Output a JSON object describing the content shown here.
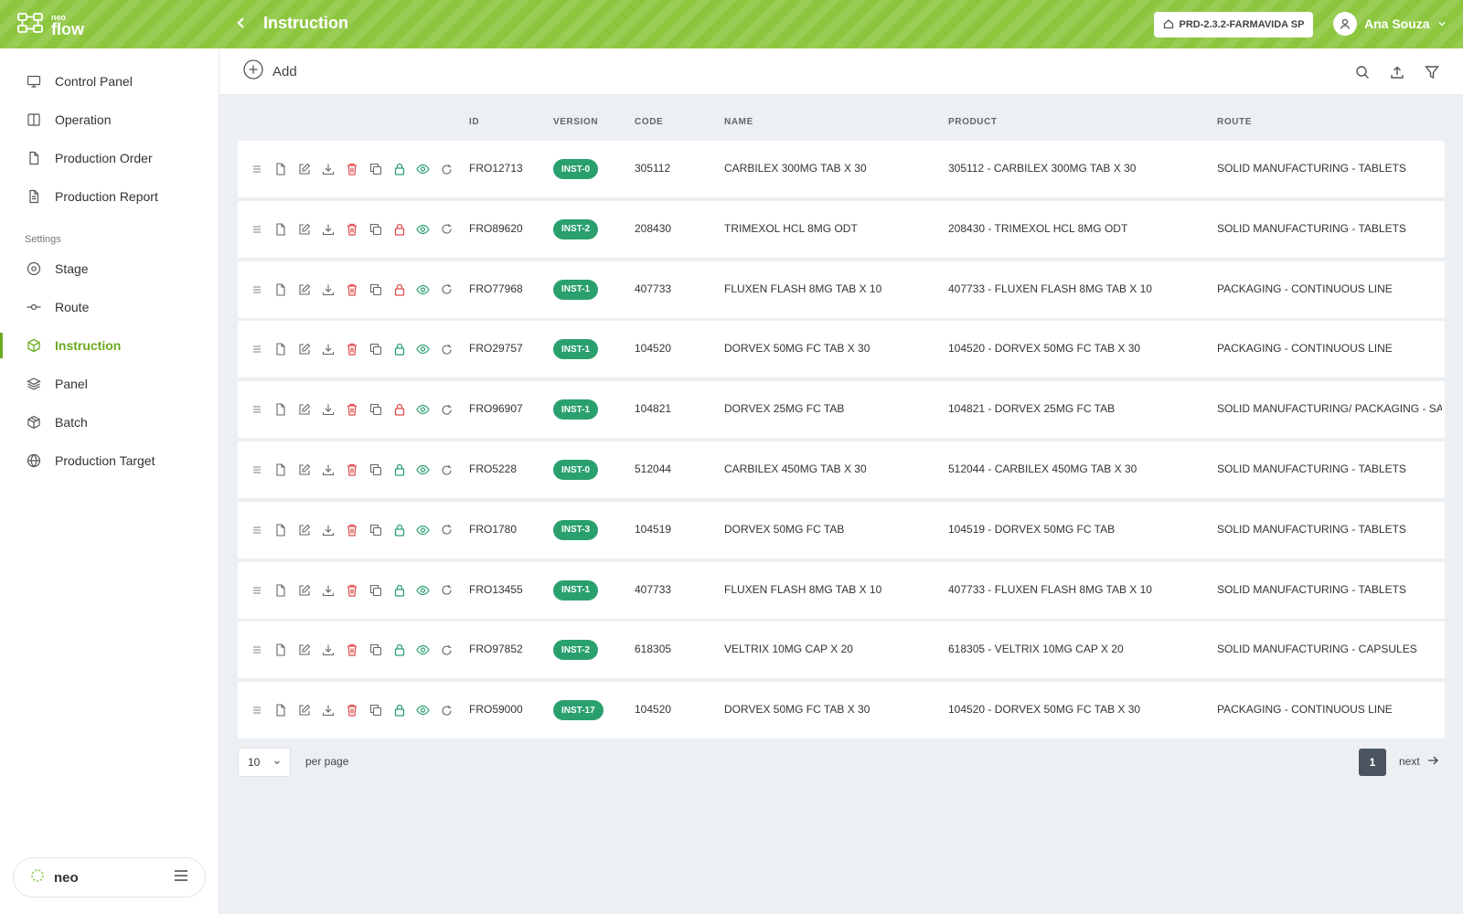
{
  "brand": {
    "small": "neo",
    "big": "flow"
  },
  "header": {
    "title": "Instruction",
    "environment": "PRD-2.3.2-FARMAVIDA SP",
    "user_name": "Ana Souza"
  },
  "sidebar": {
    "items": [
      {
        "label": "Control Panel",
        "icon": "monitor-icon"
      },
      {
        "label": "Operation",
        "icon": "columns-icon"
      },
      {
        "label": "Production Order",
        "icon": "file-icon"
      },
      {
        "label": "Production Report",
        "icon": "file-text-icon"
      }
    ],
    "settings_label": "Settings",
    "settings_items": [
      {
        "label": "Stage",
        "icon": "disc-icon"
      },
      {
        "label": "Route",
        "icon": "route-icon"
      },
      {
        "label": "Instruction",
        "icon": "box-icon",
        "active": true
      },
      {
        "label": "Panel",
        "icon": "layers-icon"
      },
      {
        "label": "Batch",
        "icon": "package-icon"
      },
      {
        "label": "Production Target",
        "icon": "globe-icon"
      }
    ],
    "footer_brand": "neo"
  },
  "toolbar": {
    "add_label": "Add"
  },
  "table": {
    "columns": {
      "id": "ID",
      "version": "VERSION",
      "code": "CODE",
      "name": "NAME",
      "product": "PRODUCT",
      "route": "ROUTE"
    },
    "rows": [
      {
        "id": "FRO12713",
        "version": "INST-0",
        "code": "305112",
        "name": "CARBILEX 300MG TAB X 30",
        "product": "305112 - CARBILEX 300MG TAB X 30",
        "route": "SOLID MANUFACTURING - TABLETS",
        "locked": false
      },
      {
        "id": "FRO89620",
        "version": "INST-2",
        "code": "208430",
        "name": "TRIMEXOL HCL 8MG ODT",
        "product": "208430 - TRIMEXOL HCL 8MG ODT",
        "route": "SOLID MANUFACTURING - TABLETS",
        "locked": true
      },
      {
        "id": "FRO77968",
        "version": "INST-1",
        "code": "407733",
        "name": "FLUXEN FLASH 8MG TAB X 10",
        "product": "407733 - FLUXEN FLASH 8MG TAB X 10",
        "route": "PACKAGING - CONTINUOUS LINE",
        "locked": true
      },
      {
        "id": "FRO29757",
        "version": "INST-1",
        "code": "104520",
        "name": "DORVEX 50MG FC TAB X 30",
        "product": "104520 - DORVEX 50MG FC TAB X 30",
        "route": "PACKAGING - CONTINUOUS LINE",
        "locked": false
      },
      {
        "id": "FRO96907",
        "version": "INST-1",
        "code": "104821",
        "name": "DORVEX 25MG FC TAB",
        "product": "104821 - DORVEX 25MG FC TAB",
        "route": "SOLID MANUFACTURING/ PACKAGING - SA",
        "locked": true
      },
      {
        "id": "FRO5228",
        "version": "INST-0",
        "code": "512044",
        "name": "CARBILEX 450MG TAB X 30",
        "product": "512044 - CARBILEX 450MG TAB X 30",
        "route": "SOLID MANUFACTURING - TABLETS",
        "locked": false
      },
      {
        "id": "FRO1780",
        "version": "INST-3",
        "code": "104519",
        "name": "DORVEX 50MG FC TAB",
        "product": "104519 - DORVEX 50MG FC TAB",
        "route": "SOLID MANUFACTURING - TABLETS",
        "locked": false
      },
      {
        "id": "FRO13455",
        "version": "INST-1",
        "code": "407733",
        "name": "FLUXEN FLASH 8MG TAB X 10",
        "product": "407733 - FLUXEN FLASH 8MG TAB X 10",
        "route": "SOLID MANUFACTURING - TABLETS",
        "locked": false
      },
      {
        "id": "FRO97852",
        "version": "INST-2",
        "code": "618305",
        "name": "VELTRIX 10MG CAP X 20",
        "product": "618305 - VELTRIX 10MG CAP X 20",
        "route": "SOLID MANUFACTURING - CAPSULES",
        "locked": false
      },
      {
        "id": "FRO59000",
        "version": "INST-17",
        "code": "104520",
        "name": "DORVEX 50MG FC TAB X 30",
        "product": "104520 - DORVEX 50MG FC TAB X 30",
        "route": "PACKAGING - CONTINUOUS LINE",
        "locked": false
      }
    ]
  },
  "pagination": {
    "per_page": "10",
    "per_page_label": "per page",
    "current_page": "1",
    "next_label": "next"
  },
  "colors": {
    "brand_green": "#8cc63f",
    "active_green": "#6aab1e",
    "badge_green": "#2aa06f",
    "delete_red": "#e04b4b",
    "lock_green": "#2aa06f",
    "lock_red": "#e04b4b"
  }
}
